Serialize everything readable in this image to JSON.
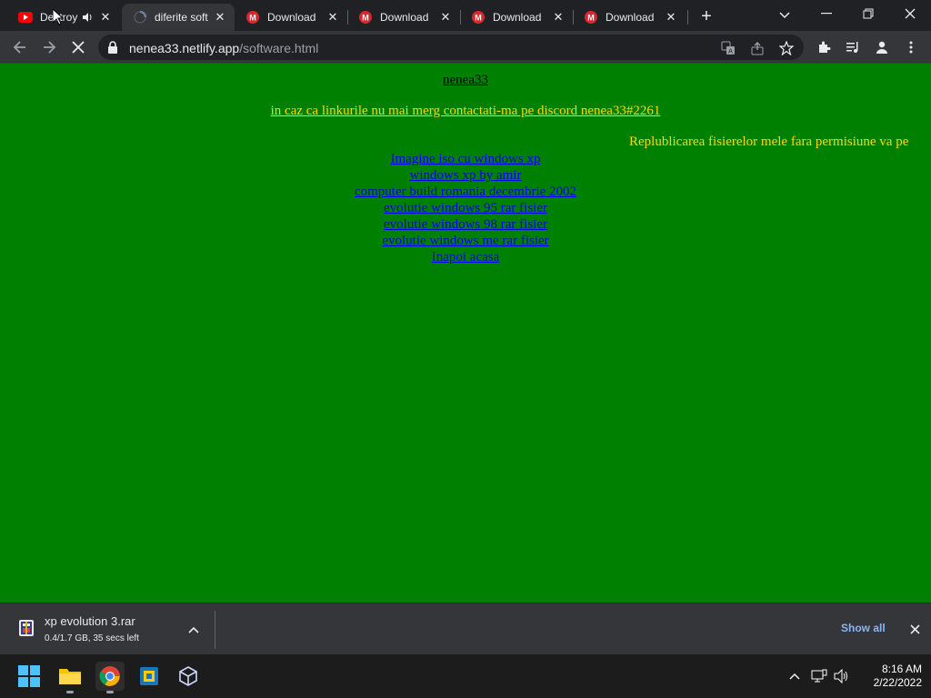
{
  "browser": {
    "tabs": [
      {
        "title": "Destroy",
        "favicon": "youtube-icon",
        "audio": true
      },
      {
        "title": "diferite soft",
        "favicon": "loading-spinner-icon",
        "active": true
      },
      {
        "title": "Download",
        "favicon": "mega-icon"
      },
      {
        "title": "Download",
        "favicon": "mega-icon"
      },
      {
        "title": "Download",
        "favicon": "mega-icon"
      },
      {
        "title": "Download",
        "favicon": "mega-icon"
      }
    ],
    "address": {
      "domain": "nenea33.netlify.app",
      "path": "/software.html"
    }
  },
  "page": {
    "site_link": "nenea33",
    "contact": "in caz ca linkurile nu mai merg contactati-ma pe discord nenea33#2261",
    "marquee": "Replublicarea fisierelor mele fara permisiune va pe",
    "links": [
      "Imagine iso cu windows xp",
      "windows xp by amir",
      "computer build romania decembrie 2002",
      "evolutie windows 95 rar fisier",
      "evolutie windows 98 rar  fisier",
      "evolutie windows me rar  fisier",
      "Inapoi acasa"
    ],
    "colors": {
      "background": "#008000",
      "link": "#0000ee",
      "highlight": "#ffd700"
    }
  },
  "downloads": {
    "file_name": "xp evolution 3.rar",
    "status": "0.4/1.7 GB, 35 secs left",
    "show_all": "Show all"
  },
  "taskbar": {
    "apps": [
      "windows-start-icon",
      "file-explorer-icon",
      "chrome-icon",
      "virtualbox-icon",
      "box-app-icon"
    ],
    "time": "8:16 AM",
    "date": "2/22/2022"
  }
}
